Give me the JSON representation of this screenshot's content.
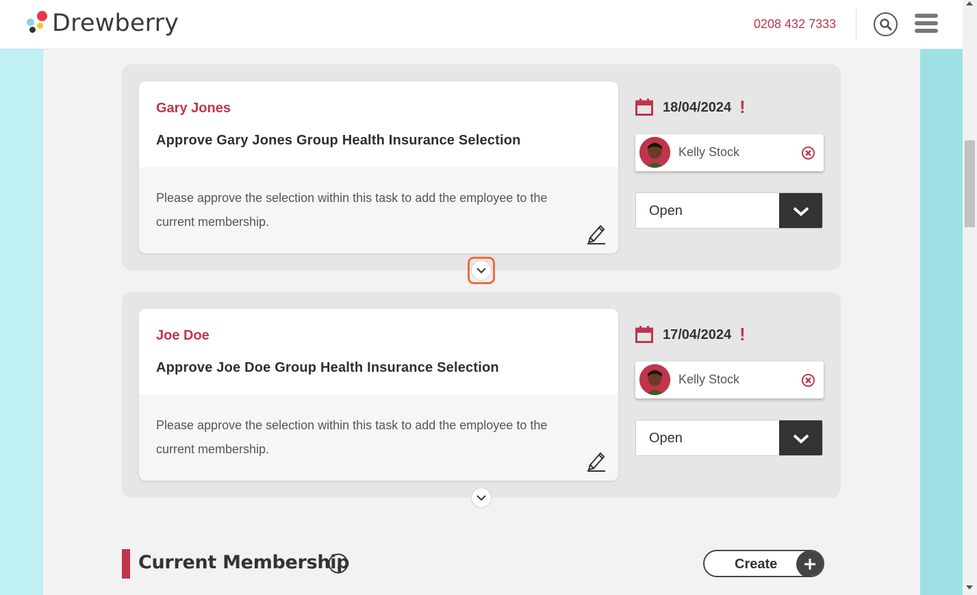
{
  "header": {
    "brand": "Drewberry",
    "phone": "0208 432 7333"
  },
  "tasks": [
    {
      "name": "Gary Jones",
      "title": "Approve Gary Jones Group Health Insurance Selection",
      "description": "Please approve the selection within this task to add the employee to the current membership.",
      "due_date": "18/04/2024",
      "urgent_mark": "!",
      "assignee": "Kelly Stock",
      "status": "Open"
    },
    {
      "name": "Joe Doe",
      "title": "Approve Joe Doe Group Health Insurance Selection",
      "description": "Please approve the selection within this task to add the employee to the current membership.",
      "due_date": "17/04/2024",
      "urgent_mark": "!",
      "assignee": "Kelly Stock",
      "status": "Open"
    }
  ],
  "section": {
    "title": "Current Membership",
    "create_label": "Create"
  },
  "colors": {
    "accent": "#c0354b",
    "focus": "#ef6a3d",
    "dark": "#333333"
  }
}
